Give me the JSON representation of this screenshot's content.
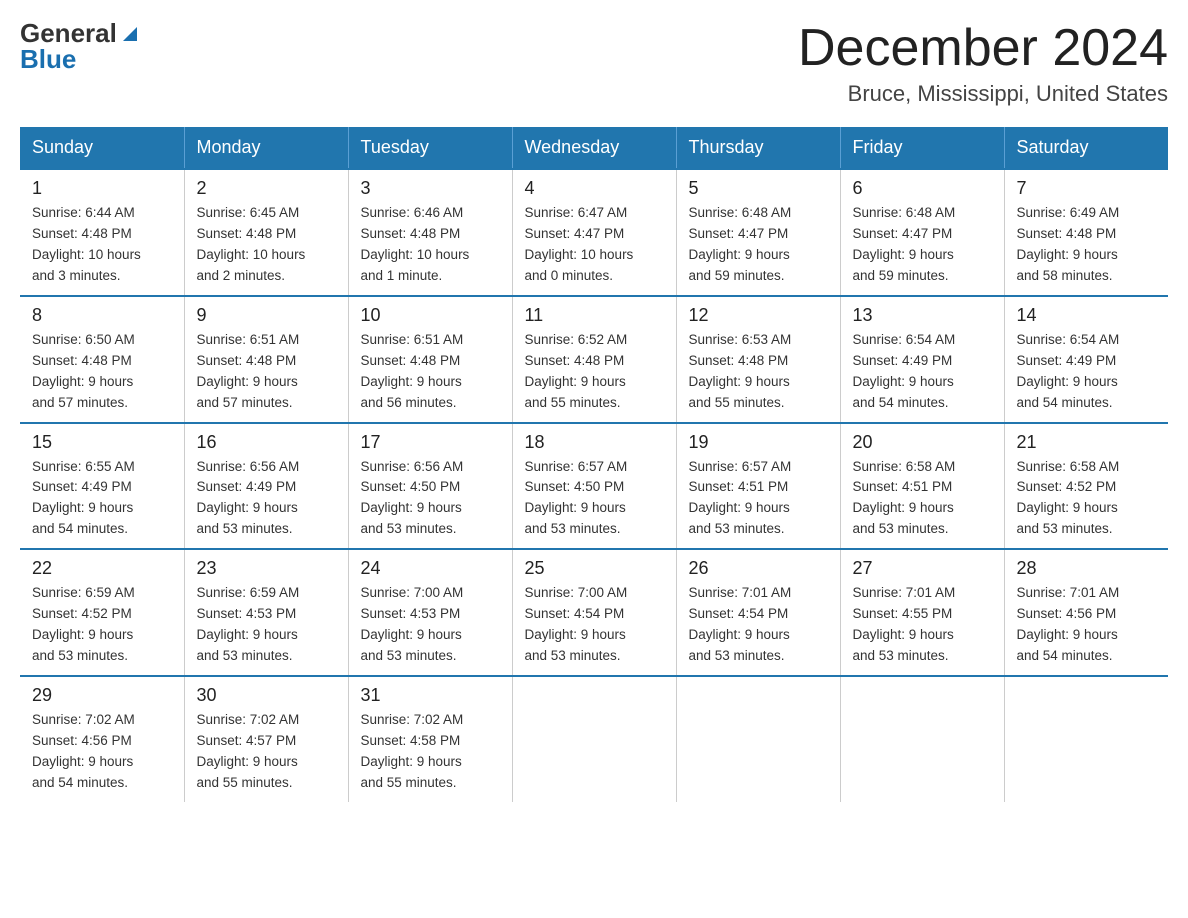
{
  "logo": {
    "general": "General",
    "blue": "Blue"
  },
  "title": {
    "month_year": "December 2024",
    "location": "Bruce, Mississippi, United States"
  },
  "weekdays": [
    "Sunday",
    "Monday",
    "Tuesday",
    "Wednesday",
    "Thursday",
    "Friday",
    "Saturday"
  ],
  "weeks": [
    [
      {
        "day": "1",
        "sunrise": "Sunrise: 6:44 AM",
        "sunset": "Sunset: 4:48 PM",
        "daylight": "Daylight: 10 hours",
        "daylight2": "and 3 minutes."
      },
      {
        "day": "2",
        "sunrise": "Sunrise: 6:45 AM",
        "sunset": "Sunset: 4:48 PM",
        "daylight": "Daylight: 10 hours",
        "daylight2": "and 2 minutes."
      },
      {
        "day": "3",
        "sunrise": "Sunrise: 6:46 AM",
        "sunset": "Sunset: 4:48 PM",
        "daylight": "Daylight: 10 hours",
        "daylight2": "and 1 minute."
      },
      {
        "day": "4",
        "sunrise": "Sunrise: 6:47 AM",
        "sunset": "Sunset: 4:47 PM",
        "daylight": "Daylight: 10 hours",
        "daylight2": "and 0 minutes."
      },
      {
        "day": "5",
        "sunrise": "Sunrise: 6:48 AM",
        "sunset": "Sunset: 4:47 PM",
        "daylight": "Daylight: 9 hours",
        "daylight2": "and 59 minutes."
      },
      {
        "day": "6",
        "sunrise": "Sunrise: 6:48 AM",
        "sunset": "Sunset: 4:47 PM",
        "daylight": "Daylight: 9 hours",
        "daylight2": "and 59 minutes."
      },
      {
        "day": "7",
        "sunrise": "Sunrise: 6:49 AM",
        "sunset": "Sunset: 4:48 PM",
        "daylight": "Daylight: 9 hours",
        "daylight2": "and 58 minutes."
      }
    ],
    [
      {
        "day": "8",
        "sunrise": "Sunrise: 6:50 AM",
        "sunset": "Sunset: 4:48 PM",
        "daylight": "Daylight: 9 hours",
        "daylight2": "and 57 minutes."
      },
      {
        "day": "9",
        "sunrise": "Sunrise: 6:51 AM",
        "sunset": "Sunset: 4:48 PM",
        "daylight": "Daylight: 9 hours",
        "daylight2": "and 57 minutes."
      },
      {
        "day": "10",
        "sunrise": "Sunrise: 6:51 AM",
        "sunset": "Sunset: 4:48 PM",
        "daylight": "Daylight: 9 hours",
        "daylight2": "and 56 minutes."
      },
      {
        "day": "11",
        "sunrise": "Sunrise: 6:52 AM",
        "sunset": "Sunset: 4:48 PM",
        "daylight": "Daylight: 9 hours",
        "daylight2": "and 55 minutes."
      },
      {
        "day": "12",
        "sunrise": "Sunrise: 6:53 AM",
        "sunset": "Sunset: 4:48 PM",
        "daylight": "Daylight: 9 hours",
        "daylight2": "and 55 minutes."
      },
      {
        "day": "13",
        "sunrise": "Sunrise: 6:54 AM",
        "sunset": "Sunset: 4:49 PM",
        "daylight": "Daylight: 9 hours",
        "daylight2": "and 54 minutes."
      },
      {
        "day": "14",
        "sunrise": "Sunrise: 6:54 AM",
        "sunset": "Sunset: 4:49 PM",
        "daylight": "Daylight: 9 hours",
        "daylight2": "and 54 minutes."
      }
    ],
    [
      {
        "day": "15",
        "sunrise": "Sunrise: 6:55 AM",
        "sunset": "Sunset: 4:49 PM",
        "daylight": "Daylight: 9 hours",
        "daylight2": "and 54 minutes."
      },
      {
        "day": "16",
        "sunrise": "Sunrise: 6:56 AM",
        "sunset": "Sunset: 4:49 PM",
        "daylight": "Daylight: 9 hours",
        "daylight2": "and 53 minutes."
      },
      {
        "day": "17",
        "sunrise": "Sunrise: 6:56 AM",
        "sunset": "Sunset: 4:50 PM",
        "daylight": "Daylight: 9 hours",
        "daylight2": "and 53 minutes."
      },
      {
        "day": "18",
        "sunrise": "Sunrise: 6:57 AM",
        "sunset": "Sunset: 4:50 PM",
        "daylight": "Daylight: 9 hours",
        "daylight2": "and 53 minutes."
      },
      {
        "day": "19",
        "sunrise": "Sunrise: 6:57 AM",
        "sunset": "Sunset: 4:51 PM",
        "daylight": "Daylight: 9 hours",
        "daylight2": "and 53 minutes."
      },
      {
        "day": "20",
        "sunrise": "Sunrise: 6:58 AM",
        "sunset": "Sunset: 4:51 PM",
        "daylight": "Daylight: 9 hours",
        "daylight2": "and 53 minutes."
      },
      {
        "day": "21",
        "sunrise": "Sunrise: 6:58 AM",
        "sunset": "Sunset: 4:52 PM",
        "daylight": "Daylight: 9 hours",
        "daylight2": "and 53 minutes."
      }
    ],
    [
      {
        "day": "22",
        "sunrise": "Sunrise: 6:59 AM",
        "sunset": "Sunset: 4:52 PM",
        "daylight": "Daylight: 9 hours",
        "daylight2": "and 53 minutes."
      },
      {
        "day": "23",
        "sunrise": "Sunrise: 6:59 AM",
        "sunset": "Sunset: 4:53 PM",
        "daylight": "Daylight: 9 hours",
        "daylight2": "and 53 minutes."
      },
      {
        "day": "24",
        "sunrise": "Sunrise: 7:00 AM",
        "sunset": "Sunset: 4:53 PM",
        "daylight": "Daylight: 9 hours",
        "daylight2": "and 53 minutes."
      },
      {
        "day": "25",
        "sunrise": "Sunrise: 7:00 AM",
        "sunset": "Sunset: 4:54 PM",
        "daylight": "Daylight: 9 hours",
        "daylight2": "and 53 minutes."
      },
      {
        "day": "26",
        "sunrise": "Sunrise: 7:01 AM",
        "sunset": "Sunset: 4:54 PM",
        "daylight": "Daylight: 9 hours",
        "daylight2": "and 53 minutes."
      },
      {
        "day": "27",
        "sunrise": "Sunrise: 7:01 AM",
        "sunset": "Sunset: 4:55 PM",
        "daylight": "Daylight: 9 hours",
        "daylight2": "and 53 minutes."
      },
      {
        "day": "28",
        "sunrise": "Sunrise: 7:01 AM",
        "sunset": "Sunset: 4:56 PM",
        "daylight": "Daylight: 9 hours",
        "daylight2": "and 54 minutes."
      }
    ],
    [
      {
        "day": "29",
        "sunrise": "Sunrise: 7:02 AM",
        "sunset": "Sunset: 4:56 PM",
        "daylight": "Daylight: 9 hours",
        "daylight2": "and 54 minutes."
      },
      {
        "day": "30",
        "sunrise": "Sunrise: 7:02 AM",
        "sunset": "Sunset: 4:57 PM",
        "daylight": "Daylight: 9 hours",
        "daylight2": "and 55 minutes."
      },
      {
        "day": "31",
        "sunrise": "Sunrise: 7:02 AM",
        "sunset": "Sunset: 4:58 PM",
        "daylight": "Daylight: 9 hours",
        "daylight2": "and 55 minutes."
      },
      null,
      null,
      null,
      null
    ]
  ]
}
